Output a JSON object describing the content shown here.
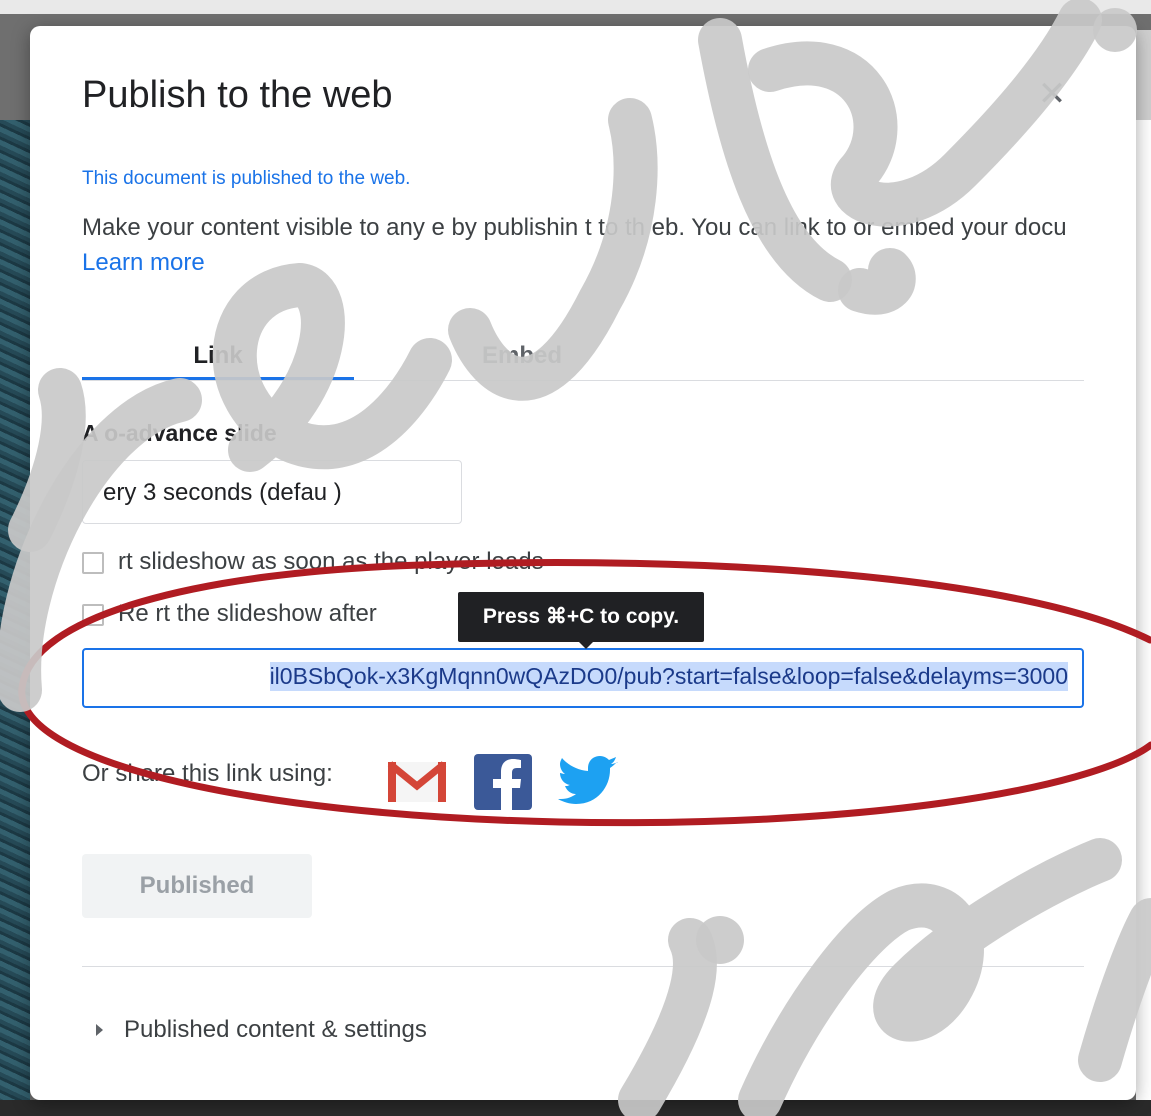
{
  "dialog": {
    "title": "Publish to the web",
    "close_icon": "close-icon",
    "published_note": "This document is published to the web.",
    "description": "Make your content visible to any  e by publishin  t to th  eb. You can link to or embed your docu  ",
    "learn_more": "Learn more",
    "tabs": [
      {
        "label": "Link"
      },
      {
        "label": "Embed"
      }
    ],
    "auto_advance_label": "A  o-advance slide",
    "auto_advance_value": "  ery 3 seconds (defau  )",
    "checkboxes": [
      {
        "label": "   rt slideshow as soon as the player loads"
      },
      {
        "label": "Re    rt the slideshow after"
      }
    ],
    "tooltip": "Press ⌘+C to copy.",
    "url_value": "il0BSbQok-x3KgMqnn0wQAzDO0/pub?start=false&loop=false&delayms=3000",
    "share_label": "Or share this link using:",
    "share_icons": [
      "gmail-icon",
      "facebook-icon",
      "twitter-icon"
    ],
    "published_button": "Published",
    "expander_label": "Published content & settings"
  },
  "colors": {
    "accent": "#1a73e8",
    "annotation_red": "#b01c22",
    "facebook": "#3b5998",
    "twitter": "#1da1f2",
    "gmail": "#d44638"
  }
}
